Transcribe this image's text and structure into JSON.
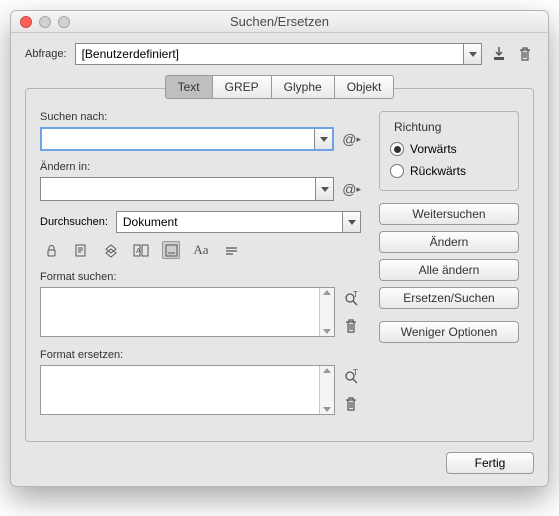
{
  "window": {
    "title": "Suchen/Ersetzen"
  },
  "query": {
    "label": "Abfrage:",
    "value": "[Benutzerdefiniert]"
  },
  "tabs": {
    "text": "Text",
    "grep": "GREP",
    "glyph": "Glyphe",
    "object": "Objekt"
  },
  "search": {
    "label": "Suchen nach:"
  },
  "change": {
    "label": "Ändern in:"
  },
  "scope": {
    "label": "Durchsuchen:",
    "value": "Dokument"
  },
  "format_search": {
    "label": "Format suchen:"
  },
  "format_replace": {
    "label": "Format ersetzen:"
  },
  "direction": {
    "legend": "Richtung",
    "forward": "Vorwärts",
    "backward": "Rückwärts"
  },
  "buttons": {
    "find_next": "Weitersuchen",
    "change": "Ändern",
    "change_all": "Alle ändern",
    "replace_find": "Ersetzen/Suchen",
    "fewer_options": "Weniger Optionen",
    "done": "Fertig"
  }
}
